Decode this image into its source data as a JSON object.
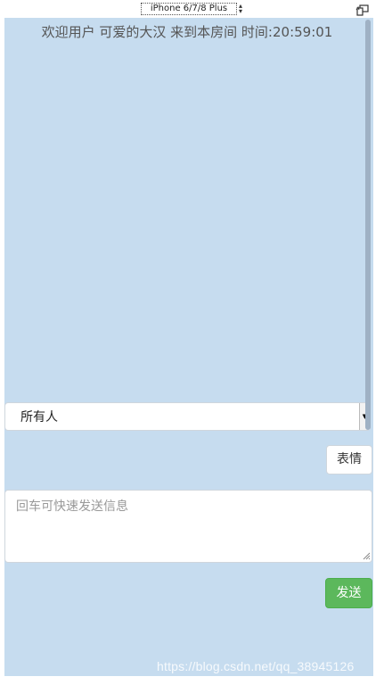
{
  "device_toolbar": {
    "device_name": "iPhone 6/7/8 Plus",
    "select_arrow_icon": "updown-arrows-icon",
    "rotate_icon": "rotate-device-icon"
  },
  "chat": {
    "welcome_text": "欢迎用户 可爱的大汉 来到本房间 时间:20:59:01",
    "recipient_select": {
      "selected": "所有人",
      "arrow_icon": "dropdown-arrow-icon"
    },
    "emoji_button_label": "表情",
    "message_input": {
      "value": "",
      "placeholder": "回车可快速发送信息"
    },
    "send_button_label": "发送"
  },
  "watermark": "https://blog.csdn.net/qq_38945126",
  "colors": {
    "background": "#c6dcef",
    "send_button": "#5cb85c"
  }
}
